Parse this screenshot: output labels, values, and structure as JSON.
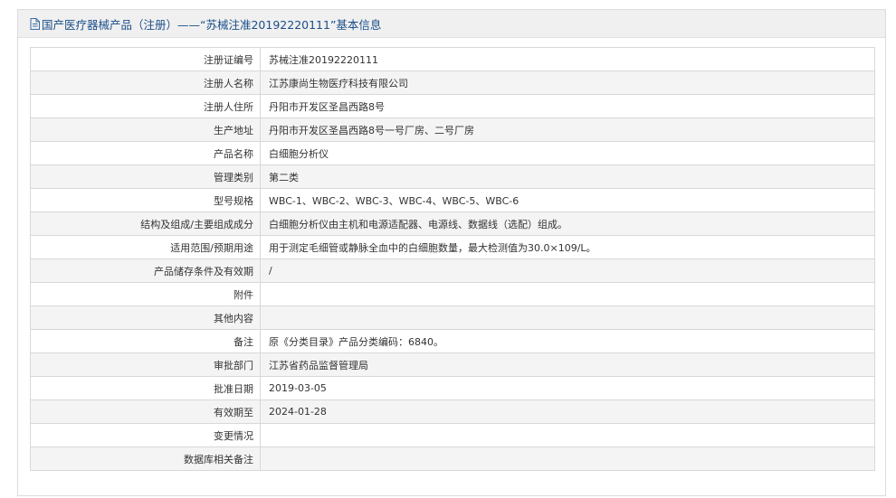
{
  "header": {
    "icon": "document-icon",
    "title": "国产医疗器械产品（注册）——“苏械注准20192220111”基本信息"
  },
  "rows": [
    {
      "label": "注册证编号",
      "value": "苏械注准20192220111"
    },
    {
      "label": "注册人名称",
      "value": "江苏康尚生物医疗科技有限公司"
    },
    {
      "label": "注册人住所",
      "value": "丹阳市开发区圣昌西路8号"
    },
    {
      "label": "生产地址",
      "value": "丹阳市开发区圣昌西路8号一号厂房、二号厂房"
    },
    {
      "label": "产品名称",
      "value": "白细胞分析仪"
    },
    {
      "label": "管理类别",
      "value": "第二类"
    },
    {
      "label": "型号规格",
      "value": "WBC-1、WBC-2、WBC-3、WBC-4、WBC-5、WBC-6"
    },
    {
      "label": "结构及组成/主要组成成分",
      "value": "白细胞分析仪由主机和电源适配器、电源线、数据线（选配）组成。"
    },
    {
      "label": "适用范围/预期用途",
      "value": "用于测定毛细管或静脉全血中的白细胞数量，最大检测值为30.0×109/L。"
    },
    {
      "label": "产品储存条件及有效期",
      "value": "/"
    },
    {
      "label": "附件",
      "value": ""
    },
    {
      "label": "其他内容",
      "value": ""
    },
    {
      "label": "备注",
      "value": "原《分类目录》产品分类编码：6840。"
    },
    {
      "label": "审批部门",
      "value": "江苏省药品监督管理局"
    },
    {
      "label": "批准日期",
      "value": "2019-03-05"
    },
    {
      "label": "有效期至",
      "value": "2024-01-28"
    },
    {
      "label": "变更情况",
      "value": ""
    },
    {
      "label": "数据库相关备注",
      "value": ""
    }
  ]
}
